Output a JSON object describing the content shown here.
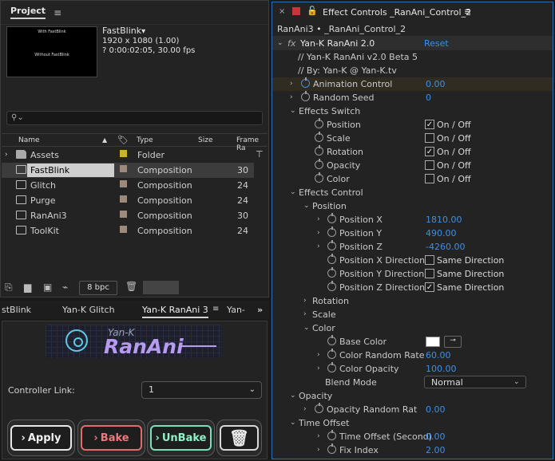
{
  "project": {
    "title": "Project",
    "comp_name": "FastBlink",
    "comp_size": "1920 x 1080 (1.00)",
    "comp_duration": "? 0:00:02:05, 30.00 fps",
    "thumb_top": "With FastBlink",
    "thumb_mid": "Without FastBlink",
    "search_placeholder": "",
    "columns": {
      "name": "Name",
      "type": "Type",
      "size": "Size",
      "frame_rate": "Frame Ra"
    },
    "rows": [
      {
        "name": "Assets",
        "type": "Folder",
        "fr": ""
      },
      {
        "name": "FastBlink",
        "type": "Composition",
        "fr": "30"
      },
      {
        "name": "Glitch",
        "type": "Composition",
        "fr": "24"
      },
      {
        "name": "Purge",
        "type": "Composition",
        "fr": "24"
      },
      {
        "name": "RanAni3",
        "type": "Composition",
        "fr": "30"
      },
      {
        "name": "ToolKit",
        "type": "Composition",
        "fr": "24"
      }
    ],
    "bpc": "8 bpc"
  },
  "bottom_tabs": [
    "stBlink",
    "Yan-K Glitch",
    "Yan-K RanAni 3",
    "Yan-"
  ],
  "controller": {
    "logo_small": "Yan-K",
    "logo_big": "RanAni",
    "link_label": "Controller Link:",
    "link_value": "1",
    "buttons": {
      "apply": "Apply",
      "bake": "Bake",
      "unbake": "UnBake"
    }
  },
  "effect_controls": {
    "title": "Effect Controls _RanAni_Control_2",
    "subtitle": "RanAni3 • _RanAni_Control_2",
    "effect_name": "Yan-K RanAni 2.0",
    "reset": "Reset",
    "version": "// Yan-K RanAni v2.0 Beta 5",
    "by": "// By: Yan-K @ Yan-K.tv",
    "animation_control": {
      "label": "Animation Control",
      "value": "0.00"
    },
    "random_seed": {
      "label": "Random Seed",
      "value": "0"
    },
    "effects_switch": "Effects Switch",
    "switches": [
      {
        "label": "Position",
        "text": "On / Off",
        "checked": "✓"
      },
      {
        "label": "Scale",
        "text": "On / Off",
        "checked": ""
      },
      {
        "label": "Rotation",
        "text": "On / Off",
        "checked": "✓"
      },
      {
        "label": "Opacity",
        "text": "On / Off",
        "checked": ""
      },
      {
        "label": "Color",
        "text": "On / Off",
        "checked": ""
      }
    ],
    "effects_control": "Effects Control",
    "position": "Position",
    "pos_x": {
      "label": "Position X",
      "value": "1810.00"
    },
    "pos_y": {
      "label": "Position Y",
      "value": "490.00"
    },
    "pos_z": {
      "label": "Position Z",
      "value": "-4260.00"
    },
    "dirs": [
      {
        "label": "Position X Direction",
        "text": "Same Direction",
        "checked": ""
      },
      {
        "label": "Position Y Direction",
        "text": "Same Direction",
        "checked": ""
      },
      {
        "label": "Position Z Direction",
        "text": "Same Direction",
        "checked": "✓"
      }
    ],
    "rotation": "Rotation",
    "scale": "Scale",
    "color": "Color",
    "base_color": "Base Color",
    "color_random_rate": {
      "label": "Color Random Rate",
      "value": "60.00"
    },
    "color_opacity": {
      "label": "Color Opacity",
      "value": "100.00"
    },
    "blend_mode": {
      "label": "Blend Mode",
      "value": "Normal"
    },
    "opacity": "Opacity",
    "opacity_random_rate": {
      "label": "Opacity Random Rat",
      "value": "0.00"
    },
    "time_offset": "Time Offset",
    "time_offset_second": {
      "label": "Time Offset (Second)",
      "value": "0.00"
    },
    "fix_index": {
      "label": "Fix Index",
      "value": "2.00"
    }
  }
}
